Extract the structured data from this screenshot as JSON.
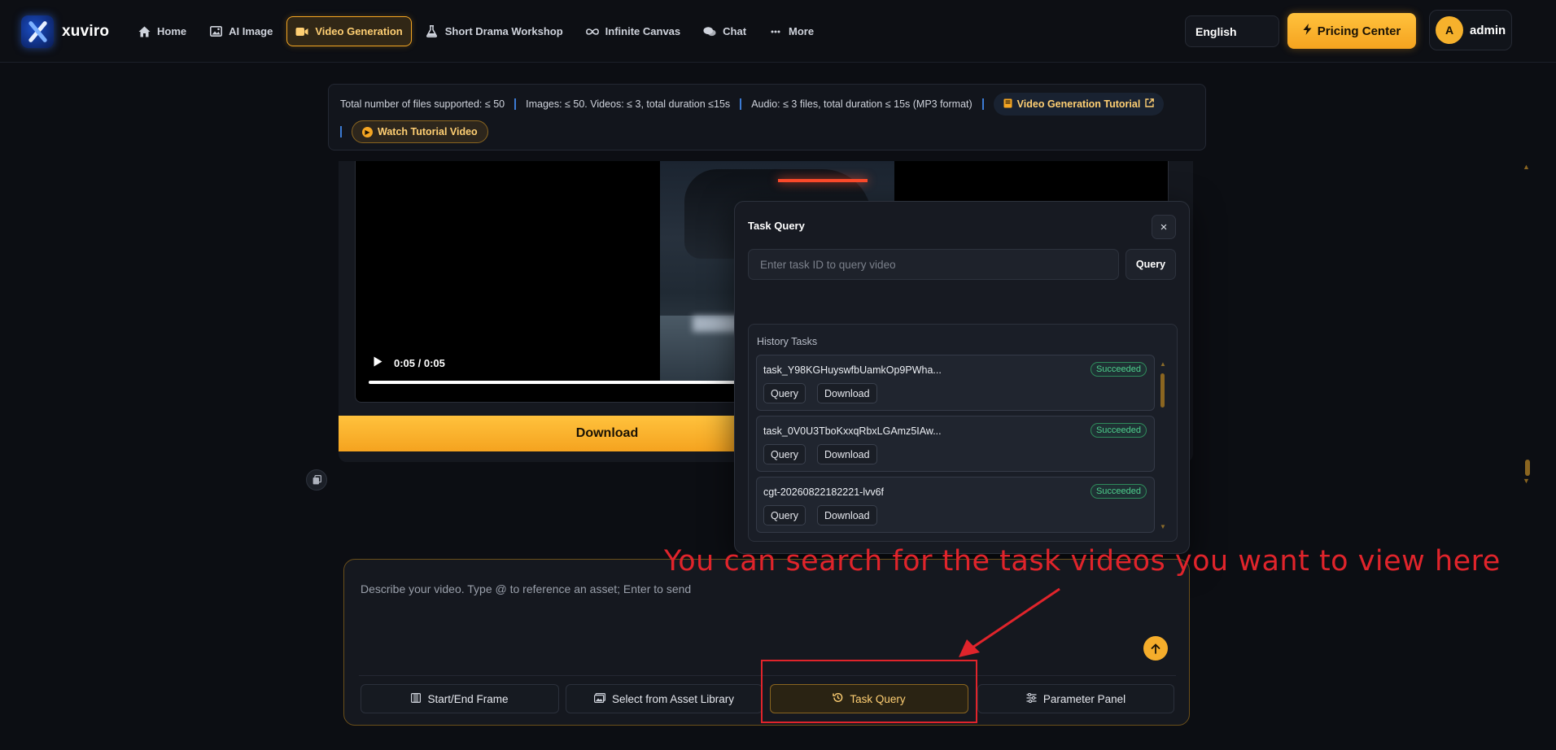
{
  "app": {
    "logo_text": "xuviro"
  },
  "nav": {
    "items": [
      {
        "label": "Home",
        "icon": "home-icon"
      },
      {
        "label": "AI Image",
        "icon": "image-icon"
      },
      {
        "label": "Video Generation",
        "icon": "video-camera-icon",
        "active": true
      },
      {
        "label": "Short Drama Workshop",
        "icon": "flask-icon"
      },
      {
        "label": "Infinite Canvas",
        "icon": "infinity-icon"
      },
      {
        "label": "Chat",
        "icon": "chat-bubbles-icon"
      },
      {
        "label": "More",
        "icon": "more-dots-icon"
      }
    ],
    "language": "English",
    "pricing_label": "Pricing Center",
    "user": {
      "initial": "A",
      "name": "admin"
    }
  },
  "infobar": {
    "files_limit": "Total number of files supported: ≤ 50",
    "images_videos_limit": "Images: ≤ 50. Videos: ≤ 3, total duration ≤15s",
    "audio_limit": "Audio: ≤ 3 files, total duration ≤ 15s (MP3 format)",
    "tutorial_label": "Video Generation Tutorial",
    "watch_label": "Watch Tutorial Video"
  },
  "player": {
    "time": "0:05 / 0:05",
    "progress": 1.0,
    "download_label": "Download"
  },
  "task_query": {
    "title": "Task Query",
    "close_glyph": "×",
    "input_placeholder": "Enter task ID to query video",
    "input_value": "",
    "query_label": "Query",
    "history_title": "History Tasks",
    "tasks": [
      {
        "id": "task_Y98KGHuyswfbUamkOp9PWha...",
        "status": "Succeeded",
        "query_label": "Query",
        "download_label": "Download"
      },
      {
        "id": "task_0V0U3TboKxxqRbxLGAmz5IAw...",
        "status": "Succeeded",
        "query_label": "Query",
        "download_label": "Download"
      },
      {
        "id": "cgt-20260822182221-lvv6f",
        "status": "Succeeded",
        "query_label": "Query",
        "download_label": "Download"
      }
    ]
  },
  "composer": {
    "placeholder": "Describe your video. Type @ to reference an asset; Enter to send",
    "tools": [
      {
        "label": "Start/End Frame",
        "icon": "film-icon"
      },
      {
        "label": "Select from Asset Library",
        "icon": "images-icon"
      },
      {
        "label": "Task Query",
        "icon": "history-icon",
        "active": true
      },
      {
        "label": "Parameter Panel",
        "icon": "sliders-icon"
      }
    ]
  },
  "annotation": {
    "text": "You can search for the task videos you want to view here",
    "color": "#e0242b"
  },
  "colors": {
    "accent": "#f5a623",
    "success": "#4ed08d",
    "background": "#0c0e13"
  }
}
